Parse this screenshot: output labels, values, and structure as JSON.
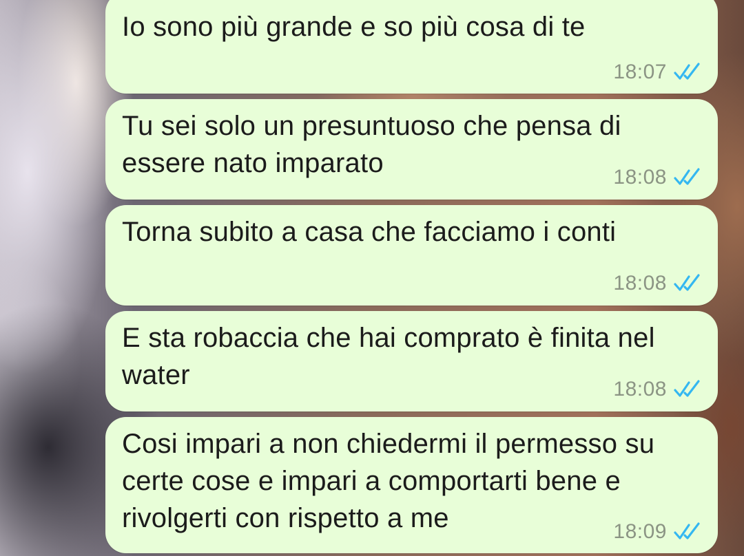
{
  "chat": {
    "messages": [
      {
        "text": "Io sono più grande e so più cosa di te",
        "time": "18:07",
        "status": "read"
      },
      {
        "text": "Tu sei solo un presuntuoso che pensa di essere nato imparato",
        "time": "18:08",
        "status": "read"
      },
      {
        "text": "Torna subito a casa che facciamo i conti",
        "time": "18:08",
        "status": "read"
      },
      {
        "text": "E sta robaccia che hai comprato è finita nel water",
        "time": "18:08",
        "status": "read"
      },
      {
        "text": "Cosi impari a non chiedermi il permesso su certe cose e impari a comportarti bene e rivolgerti con rispetto a me",
        "time": "18:09",
        "status": "read"
      }
    ]
  },
  "theme": {
    "bubble_color": "#e8fed8",
    "read_tick_color": "#34b7f1",
    "time_color": "#8b9484",
    "tick_icon": "double-check-icon"
  }
}
